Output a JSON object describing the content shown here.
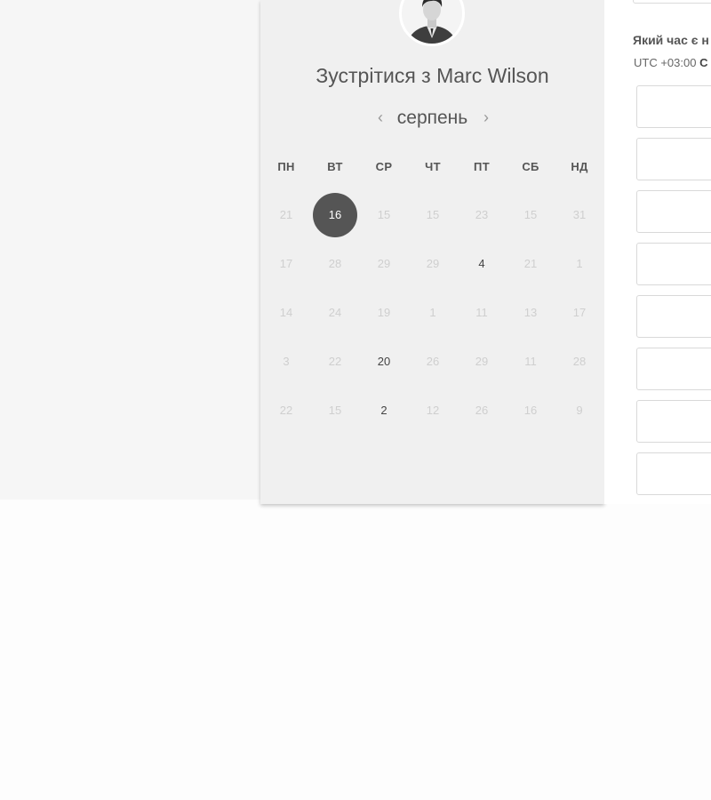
{
  "header": {
    "title_prefix": "Зустрітися з ",
    "host_name": "Marc Wilson"
  },
  "calendar": {
    "month": "серпень",
    "prev_icon": "‹",
    "next_icon": "›",
    "weekdays": [
      "ПН",
      "ВТ",
      "СР",
      "ЧТ",
      "ПТ",
      "СБ",
      "НД"
    ],
    "weeks": [
      [
        {
          "d": "21",
          "s": "disabled"
        },
        {
          "d": "16",
          "s": "selected"
        },
        {
          "d": "15",
          "s": "disabled"
        },
        {
          "d": "15",
          "s": "disabled"
        },
        {
          "d": "23",
          "s": "disabled"
        },
        {
          "d": "15",
          "s": "disabled"
        },
        {
          "d": "31",
          "s": "disabled"
        }
      ],
      [
        {
          "d": "17",
          "s": "disabled"
        },
        {
          "d": "28",
          "s": "disabled"
        },
        {
          "d": "29",
          "s": "disabled"
        },
        {
          "d": "29",
          "s": "disabled"
        },
        {
          "d": "4",
          "s": "available"
        },
        {
          "d": "21",
          "s": "disabled"
        },
        {
          "d": "1",
          "s": "disabled"
        }
      ],
      [
        {
          "d": "14",
          "s": "disabled"
        },
        {
          "d": "24",
          "s": "disabled"
        },
        {
          "d": "19",
          "s": "disabled"
        },
        {
          "d": "1",
          "s": "disabled"
        },
        {
          "d": "11",
          "s": "disabled"
        },
        {
          "d": "13",
          "s": "disabled"
        },
        {
          "d": "17",
          "s": "disabled"
        }
      ],
      [
        {
          "d": "3",
          "s": "disabled"
        },
        {
          "d": "22",
          "s": "disabled"
        },
        {
          "d": "20",
          "s": "available"
        },
        {
          "d": "26",
          "s": "disabled"
        },
        {
          "d": "29",
          "s": "disabled"
        },
        {
          "d": "11",
          "s": "disabled"
        },
        {
          "d": "28",
          "s": "disabled"
        }
      ],
      [
        {
          "d": "22",
          "s": "disabled"
        },
        {
          "d": "15",
          "s": "disabled"
        },
        {
          "d": "2",
          "s": "available"
        },
        {
          "d": "12",
          "s": "disabled"
        },
        {
          "d": "26",
          "s": "disabled"
        },
        {
          "d": "16",
          "s": "disabled"
        },
        {
          "d": "9",
          "s": "disabled"
        }
      ]
    ]
  },
  "time_panel": {
    "question": "Який час є н",
    "timezone_offset": "UTC +03:00 ",
    "timezone_rest": "С",
    "slots": [
      "",
      "",
      "",
      "",
      "",
      "",
      "",
      ""
    ]
  },
  "colors": {
    "selected_day_bg": "#555555",
    "page_bg": "#fdfdfd",
    "card_bg": "#f0f0f0"
  }
}
